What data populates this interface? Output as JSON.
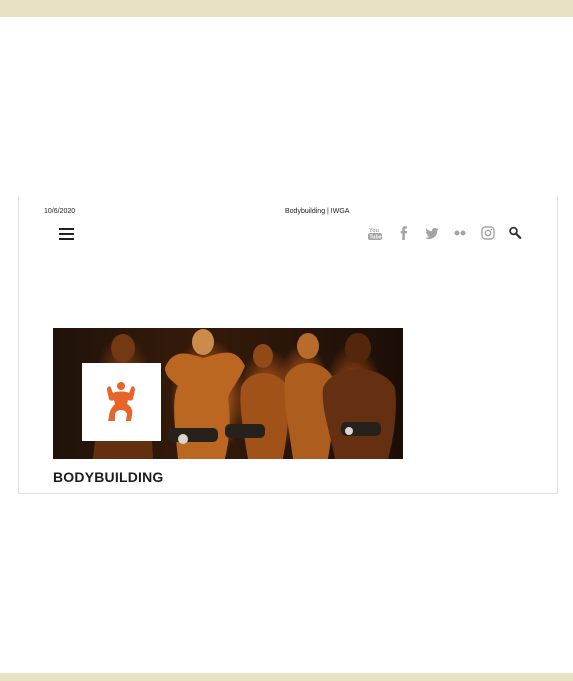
{
  "print_header": {
    "date": "10/6/2020",
    "title": "Bodybuilding | IWGA"
  },
  "social_icons": [
    "youtube-icon",
    "facebook-icon",
    "twitter-icon",
    "flickr-icon",
    "instagram-icon"
  ],
  "hero": {
    "image_alt": "bodybuilders posing",
    "logo_icon": "bodybuilding-figure-icon",
    "logo_color": "#e8652a"
  },
  "page": {
    "title": "BODYBUILDING"
  },
  "colors": {
    "band": "#e8e1c4",
    "icon_gray": "#a4a4a4"
  }
}
